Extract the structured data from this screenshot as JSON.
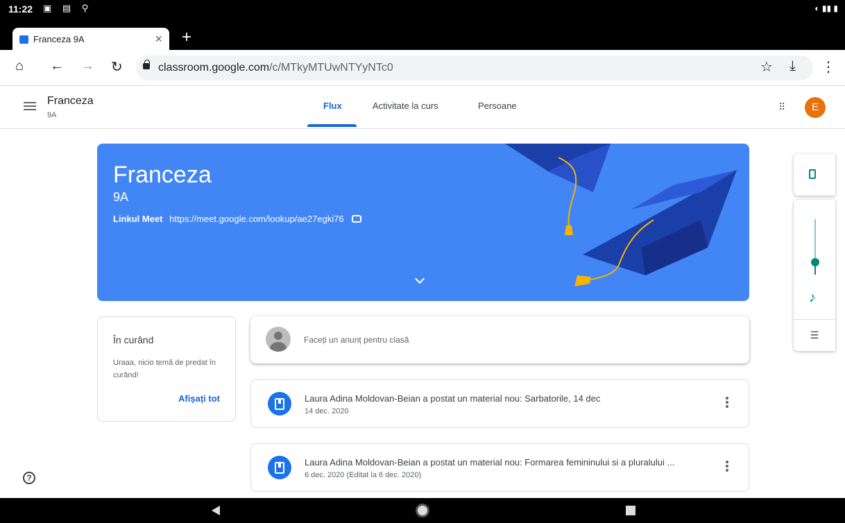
{
  "status_bar": {
    "time": "11:22"
  },
  "browser": {
    "tab_title": "Franceza 9A",
    "tab_close": "×",
    "new_tab": "+",
    "url_domain": "classroom.google.com",
    "url_path": "/c/MTkyMTUwNTYyNTc0"
  },
  "app_header": {
    "class_name": "Franceza",
    "section": "9A",
    "tabs": [
      {
        "label": "Flux",
        "active": true
      },
      {
        "label": "Activitate la curs",
        "active": false
      },
      {
        "label": "Persoane",
        "active": false
      }
    ],
    "account_initial": "E"
  },
  "banner": {
    "title": "Franceza",
    "section": "9A",
    "meet_label": "Linkul Meet",
    "meet_url": "https://meet.google.com/lookup/ae27egki76",
    "color": "#4285f4"
  },
  "upcoming": {
    "heading": "În curând",
    "message": "Uraaa, nicio temă de predat în curând!",
    "link": "Afișați tot"
  },
  "announce": {
    "placeholder": "Faceți un anunț pentru clasă"
  },
  "posts": [
    {
      "title": "Laura Adina Moldovan-Beian a postat un material nou: Sarbatorile, 14 dec",
      "date": "14 dec. 2020"
    },
    {
      "title": "Laura Adina Moldovan-Beian a postat un material nou: Formarea femininului si a pluralului ...",
      "date": "6 dec. 2020 (Editat la 6 dec. 2020)"
    }
  ],
  "help": "?",
  "accent_color": "#1967d2"
}
